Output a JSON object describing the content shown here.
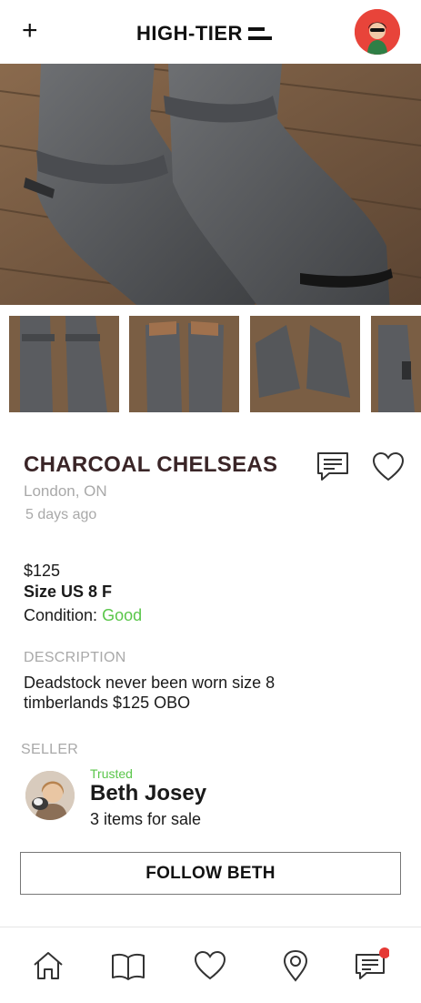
{
  "header": {
    "plus_label": "+",
    "logo_text": "HIGH-TIER",
    "avatar_icon": "user-avatar"
  },
  "listing": {
    "title": "CHARCOAL CHELSEAS",
    "location": "London, ON",
    "posted": "5 days ago",
    "price": "$125",
    "size": "Size US 8 F",
    "condition_label": "Condition:",
    "condition_value": "Good",
    "description_heading": "DESCRIPTION",
    "description": "Deadstock never been worn size 8 timberlands $125 OBO"
  },
  "seller": {
    "heading": "SELLER",
    "badge": "Trusted",
    "name": "Beth Josey",
    "items": "3 items for sale",
    "follow_label": "FOLLOW BETH"
  },
  "tabs": [
    {
      "icon": "home-icon"
    },
    {
      "icon": "book-icon"
    },
    {
      "icon": "heart-icon"
    },
    {
      "icon": "location-pin-icon"
    },
    {
      "icon": "messages-icon",
      "notification": true
    }
  ],
  "colors": {
    "accent_green": "#5ac64a",
    "title_brown": "#3a2527",
    "muted": "#a9a9a9",
    "notification_red": "#e53935"
  }
}
